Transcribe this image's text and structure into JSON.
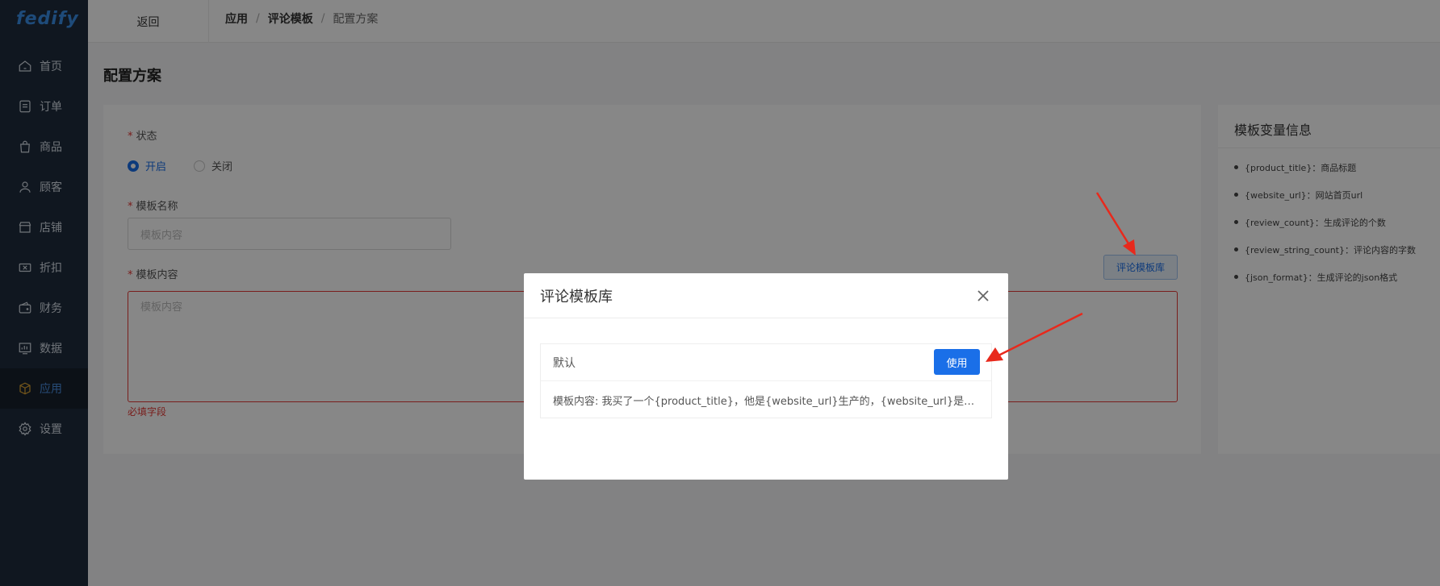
{
  "logo": "fedify",
  "sidebar": {
    "items": [
      {
        "label": "首页",
        "icon": "home-icon"
      },
      {
        "label": "订单",
        "icon": "order-icon"
      },
      {
        "label": "商品",
        "icon": "bag-icon"
      },
      {
        "label": "顾客",
        "icon": "user-icon"
      },
      {
        "label": "店铺",
        "icon": "shop-icon"
      },
      {
        "label": "折扣",
        "icon": "ticket-icon"
      },
      {
        "label": "财务",
        "icon": "wallet-icon"
      },
      {
        "label": "数据",
        "icon": "chart-icon"
      },
      {
        "label": "应用",
        "icon": "cube-icon",
        "active": true
      },
      {
        "label": "设置",
        "icon": "gear-icon"
      }
    ]
  },
  "header": {
    "back_label": "返回",
    "breadcrumb": [
      "应用",
      "评论模板",
      "配置方案"
    ],
    "separator": "/"
  },
  "page_title": "配置方案",
  "form": {
    "status_label": "状态",
    "status_on": "开启",
    "status_off": "关闭",
    "name_label": "模板名称",
    "name_placeholder": "模板内容",
    "content_label": "模板内容",
    "content_placeholder": "模板内容",
    "required_error": "必填字段",
    "required_mark": "*",
    "library_button": "评论模板库"
  },
  "variables": {
    "title": "模板变量信息",
    "items": [
      "{product_title}：商品标题",
      "{website_url}：网站首页url",
      "{review_count}：生成评论的个数",
      "{review_string_count}：评论内容的字数",
      "{json_format}：生成评论的json格式"
    ]
  },
  "modal": {
    "title": "评论模板库",
    "template_name": "默认",
    "use_button": "使用",
    "template_content": "模板内容: 我买了一个{product_title}，他是{website_url}生产的，{website_url}是专门..."
  },
  "colors": {
    "accent": "#1a6fe8",
    "sidebar_bg": "#1f2d3d",
    "error": "#e53935",
    "arrow": "#e8291c"
  }
}
